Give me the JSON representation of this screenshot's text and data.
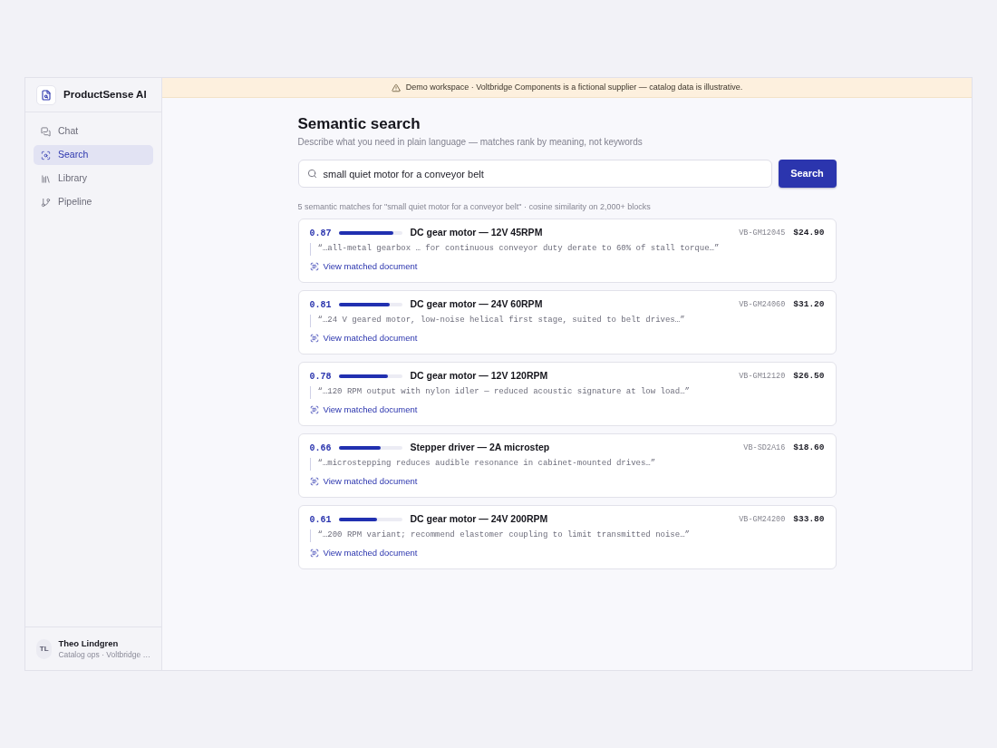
{
  "app": {
    "name": "ProductSense AI"
  },
  "sidebar": {
    "items": [
      {
        "label": "Chat",
        "selected": false
      },
      {
        "label": "Search",
        "selected": true
      },
      {
        "label": "Library",
        "selected": false
      },
      {
        "label": "Pipeline",
        "selected": false
      }
    ]
  },
  "user": {
    "initials": "TL",
    "name": "Theo Lindgren",
    "subtitle": "Catalog ops · Voltbridge …"
  },
  "banner": {
    "text": "Demo workspace · Voltbridge Components is a fictional supplier — catalog data is illustrative."
  },
  "search": {
    "title": "Semantic search",
    "subtitle": "Describe what you need in plain language — matches rank by meaning, not keywords",
    "query": "small quiet motor for a conveyor belt",
    "button": "Search",
    "summary": "5 semantic matches for \"small quiet motor for a conveyor belt\" · cosine similarity on 2,000+ blocks"
  },
  "results": [
    {
      "score": "0.87",
      "level": 0.87,
      "title": "DC gear motor — 12V 45RPM",
      "sku": "VB-GM12045",
      "price": "$24.90",
      "quote": "“…all-metal gearbox … for continuous conveyor duty derate to 60% of stall torque…”",
      "link": "View matched document"
    },
    {
      "score": "0.81",
      "level": 0.81,
      "title": "DC gear motor — 24V 60RPM",
      "sku": "VB-GM24060",
      "price": "$31.20",
      "quote": "“…24 V geared motor, low-noise helical first stage, suited to belt drives…”",
      "link": "View matched document"
    },
    {
      "score": "0.78",
      "level": 0.78,
      "title": "DC gear motor — 12V 120RPM",
      "sku": "VB-GM12120",
      "price": "$26.50",
      "quote": "“…120 RPM output with nylon idler — reduced acoustic signature at low load…”",
      "link": "View matched document"
    },
    {
      "score": "0.66",
      "level": 0.66,
      "title": "Stepper driver — 2A microstep",
      "sku": "VB-SD2A16",
      "price": "$18.60",
      "quote": "“…microstepping reduces audible resonance in cabinet-mounted drives…”",
      "link": "View matched document"
    },
    {
      "score": "0.61",
      "level": 0.61,
      "title": "DC gear motor — 24V 200RPM",
      "sku": "VB-GM24200",
      "price": "$33.80",
      "quote": "“…200 RPM variant; recommend elastomer coupling to limit transmitted noise…”",
      "link": "View matched document"
    }
  ]
}
